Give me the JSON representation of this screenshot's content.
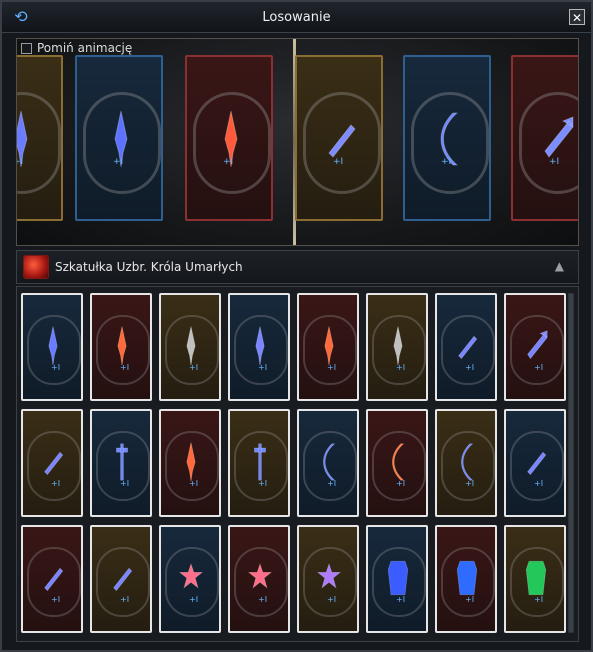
{
  "window": {
    "title": "Losowanie",
    "close_icon": "close-icon"
  },
  "reel": {
    "skip_label": "Pomiń animację",
    "cards": [
      {
        "frame": "gold",
        "item": "sword",
        "item_color": "#6a7cff",
        "tag": "+I"
      },
      {
        "frame": "blue",
        "item": "sword",
        "item_color": "#5d73ff",
        "tag": "+I"
      },
      {
        "frame": "red",
        "item": "sword",
        "item_color": "#ff5a3c",
        "tag": "+I"
      },
      {
        "frame": "gold",
        "item": "dagger",
        "item_color": "#7e8cff",
        "tag": "+I"
      },
      {
        "frame": "blue",
        "item": "bow",
        "item_color": "#6f88ff",
        "tag": "+I"
      },
      {
        "frame": "red",
        "item": "fan",
        "item_color": "#7c8dff",
        "tag": "+I"
      }
    ]
  },
  "box": {
    "title": "Szkatułka Uzbr. Króla Umarłych",
    "collapse_icon": "collapse-up-icon"
  },
  "grid": {
    "rows": [
      [
        {
          "frame": "blue",
          "item": "sword",
          "item_color": "#6a7cff",
          "tag": "+I"
        },
        {
          "frame": "red",
          "item": "sword",
          "item_color": "#ff6a3c",
          "tag": "+I"
        },
        {
          "frame": "gold",
          "item": "sword",
          "item_color": "#c0c0c0",
          "tag": "+I"
        },
        {
          "frame": "blue",
          "item": "sword",
          "item_color": "#7a86ff",
          "tag": "+I"
        },
        {
          "frame": "red",
          "item": "sword",
          "item_color": "#ff6a3c",
          "tag": "+I"
        },
        {
          "frame": "gold",
          "item": "sword",
          "item_color": "#c0c0c0",
          "tag": "+I"
        },
        {
          "frame": "blue",
          "item": "dagger",
          "item_color": "#7a86ff",
          "tag": "+I"
        },
        {
          "frame": "red",
          "item": "fan",
          "item_color": "#7a86ff",
          "tag": "+I"
        }
      ],
      [
        {
          "frame": "gold",
          "item": "dagger",
          "item_color": "#7a86ff",
          "tag": "+I"
        },
        {
          "frame": "blue",
          "item": "staff",
          "item_color": "#6f88ff",
          "tag": "+I"
        },
        {
          "frame": "red",
          "item": "sword",
          "item_color": "#ff6a3c",
          "tag": "+I"
        },
        {
          "frame": "gold",
          "item": "staff",
          "item_color": "#6f88ff",
          "tag": "+I"
        },
        {
          "frame": "blue",
          "item": "bow",
          "item_color": "#6f88ff",
          "tag": "+I"
        },
        {
          "frame": "red",
          "item": "bow",
          "item_color": "#ff7a3c",
          "tag": "+I"
        },
        {
          "frame": "gold",
          "item": "bow",
          "item_color": "#6f88ff",
          "tag": "+I"
        },
        {
          "frame": "blue",
          "item": "dagger",
          "item_color": "#7a86ff",
          "tag": "+I"
        }
      ],
      [
        {
          "frame": "red",
          "item": "dagger",
          "item_color": "#7a86ff",
          "tag": "+I"
        },
        {
          "frame": "gold",
          "item": "dagger",
          "item_color": "#7a86ff",
          "tag": "+I"
        },
        {
          "frame": "blue",
          "item": "bell",
          "item_color": "#ff6e8a",
          "tag": "+I"
        },
        {
          "frame": "red",
          "item": "bell",
          "item_color": "#ff6e8a",
          "tag": "+I"
        },
        {
          "frame": "gold",
          "item": "bell",
          "item_color": "#b07cff",
          "tag": "+I"
        },
        {
          "frame": "blue",
          "item": "armor",
          "item_color": "#3b5cff",
          "tag": "+I"
        },
        {
          "frame": "red",
          "item": "armor",
          "item_color": "#2f6bff",
          "tag": "+I"
        },
        {
          "frame": "gold",
          "item": "armor",
          "item_color": "#24c85a",
          "tag": "+I"
        }
      ]
    ]
  }
}
